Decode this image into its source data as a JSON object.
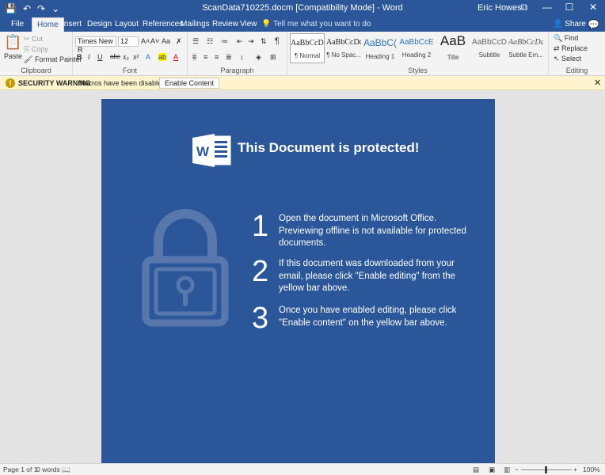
{
  "window": {
    "title": "ScanData710225.docm [Compatibility Mode] - Word",
    "user": "Eric Howes",
    "controls": [
      "⧉",
      "—",
      "☐",
      "✕"
    ]
  },
  "qat": {
    "save": "💾",
    "undo": "↶",
    "redo": "↷",
    "customize": "⌄"
  },
  "tabs": [
    "File",
    "Home",
    "Insert",
    "Design",
    "Layout",
    "References",
    "Mailings",
    "Review",
    "View"
  ],
  "tell_me": "Tell me what you want to do",
  "share": "Share",
  "ribbon": {
    "clipboard": {
      "paste": "Paste",
      "cut": "Cut",
      "copy": "Copy",
      "format_painter": "Format Painter",
      "label": "Clipboard"
    },
    "font": {
      "name": "Times New R",
      "size": "12",
      "grow": "A˄",
      "shrink": "A˅",
      "case": "Aa",
      "clear": "✗",
      "bold": "B",
      "italic": "I",
      "underline": "U",
      "strike": "abc",
      "subscript": "x₂",
      "superscript": "x²",
      "effects": "A",
      "highlight": "ab",
      "color": "A",
      "label": "Font"
    },
    "paragraph": {
      "label": "Paragraph",
      "pilcrow": "¶"
    },
    "styles": {
      "items": [
        {
          "sample": "AaBbCcDd",
          "name": "¶ Normal"
        },
        {
          "sample": "AaBbCcDd",
          "name": "¶ No Spac..."
        },
        {
          "sample": "AaBbC(",
          "name": "Heading 1"
        },
        {
          "sample": "AaBbCcE",
          "name": "Heading 2"
        },
        {
          "sample": "AaB",
          "name": "Title"
        },
        {
          "sample": "AaBbCcD",
          "name": "Subtitle"
        },
        {
          "sample": "AaBbCcDdE",
          "name": "Subtle Em..."
        }
      ],
      "label": "Styles"
    },
    "editing": {
      "find": "Find",
      "replace": "Replace",
      "select": "Select",
      "label": "Editing"
    }
  },
  "security": {
    "title": "SECURITY WARNING",
    "message": "Macros have been disabled.",
    "button": "Enable Content"
  },
  "document": {
    "headline": "This Document is protected!",
    "logo_letter": "W",
    "steps": [
      {
        "num": "1",
        "text": "Open the document in Microsoft Office. Previewing offline is not available for protected documents."
      },
      {
        "num": "2",
        "text": "If this document was downloaded from your email, please click \"Enable editing\" from the yellow bar above."
      },
      {
        "num": "3",
        "text": "Once you have enabled editing, please click \"Enable content\" on the yellow bar above."
      }
    ]
  },
  "status": {
    "page": "Page 1 of 1",
    "words": "0 words",
    "zoom": "100%"
  },
  "colors": {
    "word_blue": "#2b579a",
    "warning_bg": "#fff4ce"
  }
}
